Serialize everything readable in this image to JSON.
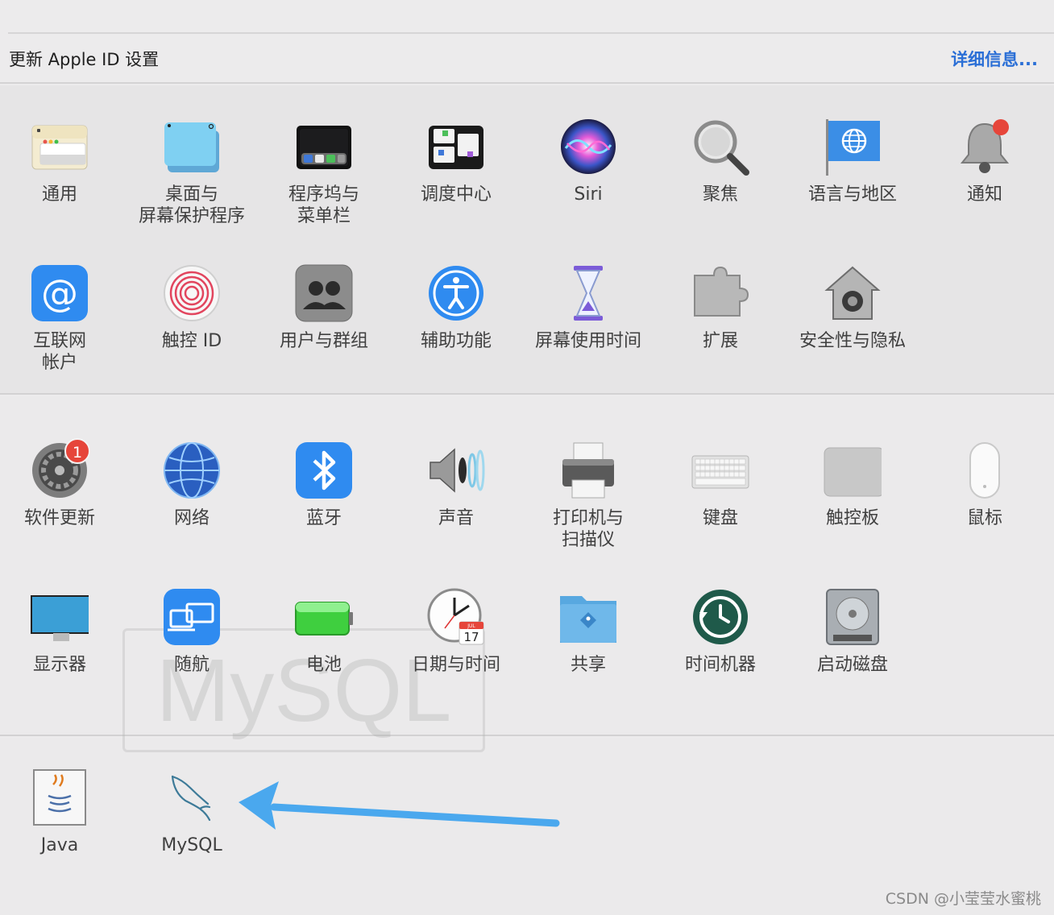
{
  "update_bar": {
    "text": "更新 Apple ID 设置",
    "link": "详细信息..."
  },
  "row1": [
    {
      "label": "通用",
      "icon": "general-icon"
    },
    {
      "label": "桌面与\n屏幕保护程序",
      "icon": "desktop-icon"
    },
    {
      "label": "程序坞与\n菜单栏",
      "icon": "dock-icon"
    },
    {
      "label": "调度中心",
      "icon": "mission-control-icon"
    },
    {
      "label": "Siri",
      "icon": "siri-icon"
    },
    {
      "label": "聚焦",
      "icon": "spotlight-icon"
    },
    {
      "label": "语言与地区",
      "icon": "language-icon"
    },
    {
      "label": "通知",
      "icon": "notification-icon"
    }
  ],
  "row2": [
    {
      "label": "互联网\n帐户",
      "icon": "internet-accounts-icon"
    },
    {
      "label": "触控 ID",
      "icon": "touch-id-icon"
    },
    {
      "label": "用户与群组",
      "icon": "users-groups-icon"
    },
    {
      "label": "辅助功能",
      "icon": "accessibility-icon"
    },
    {
      "label": "屏幕使用时间",
      "icon": "screen-time-icon"
    },
    {
      "label": "扩展",
      "icon": "extensions-icon"
    },
    {
      "label": "安全性与隐私",
      "icon": "security-icon"
    }
  ],
  "row3": [
    {
      "label": "软件更新",
      "icon": "software-update-icon",
      "badge": "1"
    },
    {
      "label": "网络",
      "icon": "network-icon"
    },
    {
      "label": "蓝牙",
      "icon": "bluetooth-icon"
    },
    {
      "label": "声音",
      "icon": "sound-icon"
    },
    {
      "label": "打印机与\n扫描仪",
      "icon": "printer-icon"
    },
    {
      "label": "键盘",
      "icon": "keyboard-icon"
    },
    {
      "label": "触控板",
      "icon": "trackpad-icon"
    },
    {
      "label": "鼠标",
      "icon": "mouse-icon"
    }
  ],
  "row4": [
    {
      "label": "显示器",
      "icon": "displays-icon"
    },
    {
      "label": "随航",
      "icon": "sidecar-icon"
    },
    {
      "label": "电池",
      "icon": "battery-icon"
    },
    {
      "label": "日期与时间",
      "icon": "date-time-icon",
      "calendar_month": "JUL",
      "calendar_day": "17"
    },
    {
      "label": "共享",
      "icon": "sharing-icon"
    },
    {
      "label": "时间机器",
      "icon": "time-machine-icon"
    },
    {
      "label": "启动磁盘",
      "icon": "startup-disk-icon"
    }
  ],
  "row5": [
    {
      "label": "Java",
      "icon": "java-icon"
    },
    {
      "label": "MySQL",
      "icon": "mysql-icon"
    }
  ],
  "watermark_text": "MySQL",
  "footer_credit": "CSDN @小莹莹水蜜桃",
  "colors": {
    "link": "#2b6fd6",
    "arrow": "#4aa8ee",
    "badge": "#e6453a"
  }
}
